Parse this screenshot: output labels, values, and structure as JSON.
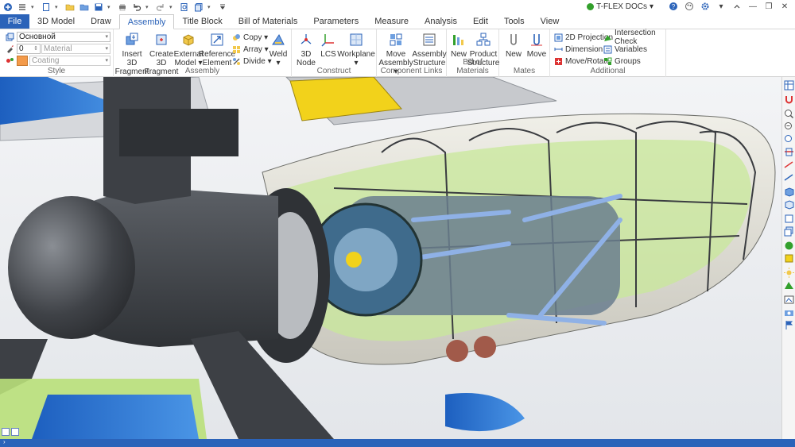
{
  "app": {
    "product_label": "T-FLEX DOCs",
    "product_arrow": "▾"
  },
  "window_controls": {
    "minimize": "—",
    "restore": "❐",
    "close": "✕"
  },
  "tabs": [
    {
      "label": "File"
    },
    {
      "label": "3D Model"
    },
    {
      "label": "Draw"
    },
    {
      "label": "Assembly"
    },
    {
      "label": "Title Block"
    },
    {
      "label": "Bill of Materials"
    },
    {
      "label": "Parameters"
    },
    {
      "label": "Measure"
    },
    {
      "label": "Analysis"
    },
    {
      "label": "Edit"
    },
    {
      "label": "Tools"
    },
    {
      "label": "View"
    }
  ],
  "style_group": {
    "layer_value": "Основной",
    "color_value": "0",
    "material_placeholder": "Material",
    "coating_placeholder": "Coating",
    "label": "Style"
  },
  "assembly_group": {
    "insert": "Insert 3D Fragment",
    "insert_l1": "Insert 3D",
    "insert_l2": "Fragment",
    "create_l1": "Create 3D",
    "create_l2": "Fragment",
    "external_l1": "External",
    "external_l2": "Model ▾",
    "reference_l1": "Reference",
    "reference_l2": "Element",
    "copy": "Copy ▾",
    "array": "Array ▾",
    "divide": "Divide ▾",
    "weld": "Weld",
    "weld_arrow": "▾",
    "label": "Assembly"
  },
  "construct_group": {
    "node_l1": "3D",
    "node_l2": "Node",
    "lcs": "LCS",
    "workplane": "Workplane",
    "workplane_arrow": "▾",
    "label": "Construct"
  },
  "component_group": {
    "move_l1": "Move",
    "move_l2": "Assembly ▾",
    "structure_l1": "Assembly",
    "structure_l2": "Structure",
    "label": "Component Links"
  },
  "bom_group": {
    "new": "New",
    "product_l1": "Product",
    "product_l2": "Structure",
    "label": "Bill of Materials"
  },
  "mates_group": {
    "new": "New",
    "move": "Move",
    "label": "Mates"
  },
  "additional_group": {
    "projection": "2D Projection",
    "dimension": "Dimension ▾",
    "move_rotate": "Move/Rotate",
    "intersection": "Intersection Check",
    "variables": "Variables",
    "groups": "Groups",
    "label": "Additional"
  },
  "colors": {
    "accent": "#2b63b9",
    "tab_file_bg": "#2b63b9",
    "body_dark": "#4a4d52",
    "frame_green": "#b9e07a",
    "wing_blue": "#2f7fd8"
  },
  "right_toolbar_icons": [
    "pages-icon",
    "magnet-icon",
    "zoom-in-icon",
    "zoom-out-icon",
    "zoom-fit-icon",
    "section-icon",
    "arrow-measure-icon",
    "arrow-measure2-icon",
    "cube-icon",
    "cube-view-icon",
    "box-icon",
    "layers-icon",
    "sphere-icon",
    "yellow-box-icon",
    "sun-icon",
    "green-shape-icon",
    "render-icon",
    "camera-icon",
    "flag-icon"
  ]
}
